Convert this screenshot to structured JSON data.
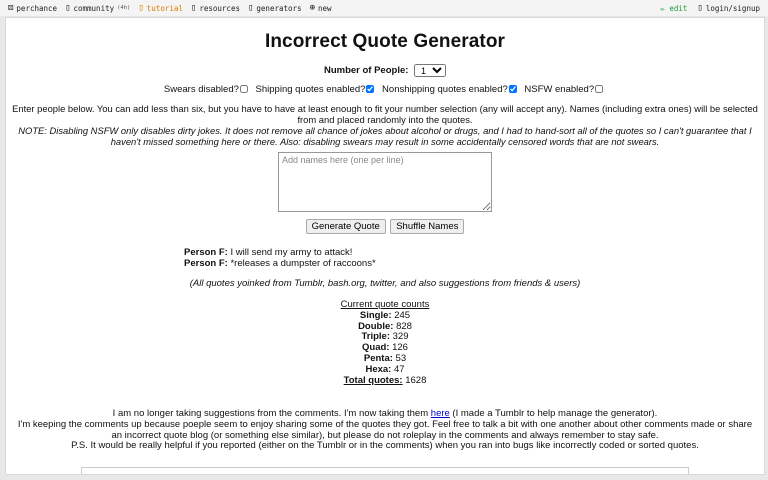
{
  "topbar": {
    "items": [
      {
        "label": "perchance",
        "icon": "dice-icon"
      },
      {
        "label": "community",
        "badge": "(4h)",
        "icon": "chat-icon"
      },
      {
        "label": "tutorial",
        "icon": "book-icon"
      },
      {
        "label": "resources",
        "icon": "folder-icon"
      },
      {
        "label": "generators",
        "icon": "grid-icon"
      },
      {
        "label": "new",
        "icon": "plus-circle-icon"
      }
    ],
    "edit_label": "✏ edit",
    "login_label": "login/signup"
  },
  "title": "Incorrect Quote Generator",
  "people": {
    "label": "Number of People:",
    "selected": "1"
  },
  "options": {
    "swears": "Swears disabled?",
    "shipping": "Shipping quotes enabled?",
    "nonshipping": "Nonshipping quotes enabled?",
    "nsfw": "NSFW enabled?"
  },
  "instructions": "Enter people below. You can add less than six, but you have to have at least enough to fit your number selection (any will accept any). Names (including extra ones) will be selected from and placed randomly into the quotes.",
  "note": "NOTE: Disabling NSFW only disables dirty jokes. It does not remove all chance of jokes about alcohol or drugs, and I had to hand-sort all of the quotes so I can't guarantee that I haven't missed something here or there. Also: disabling swears may result in some accidentally censored words that are not swears.",
  "names_placeholder": "Add names here (one per line)",
  "buttons": {
    "generate": "Generate Quote",
    "shuffle": "Shuffle Names"
  },
  "quotes": [
    {
      "speaker": "Person F:",
      "text": " I will send my army to attack!"
    },
    {
      "speaker": "Person F:",
      "text": " *releases a dumpster of raccoons*"
    }
  ],
  "credit": "(All quotes yoinked from Tumblr, bash.org, twitter, and also suggestions from friends & users)",
  "counts": {
    "heading": "Current quote counts",
    "rows": [
      {
        "label": "Single:",
        "value": "245"
      },
      {
        "label": "Double:",
        "value": "828"
      },
      {
        "label": "Triple:",
        "value": "329"
      },
      {
        "label": "Quad:",
        "value": "126"
      },
      {
        "label": "Penta:",
        "value": "53"
      },
      {
        "label": "Hexa:",
        "value": "47"
      }
    ],
    "total_label": "Total quotes:",
    "total_value": "1628"
  },
  "footer": {
    "line1a": "I am no longer taking suggestions from the comments. I'm now taking them ",
    "link": "here",
    "line1b": " (I made a Tumblr to help manage the generator).",
    "line2": "I'm keeping the comments up because poeple seem to enjoy sharing some of the quotes they got. Feel free to talk a bit with one another about other comments made or share an incorrect quote blog (or something else similar), but please do not roleplay in the comments and always remember to stay safe.",
    "line3": "P.S. It would be really helpful if you reported (either on the Tumblr or in the comments) when you ran into bugs like incorrectly coded or sorted quotes."
  }
}
